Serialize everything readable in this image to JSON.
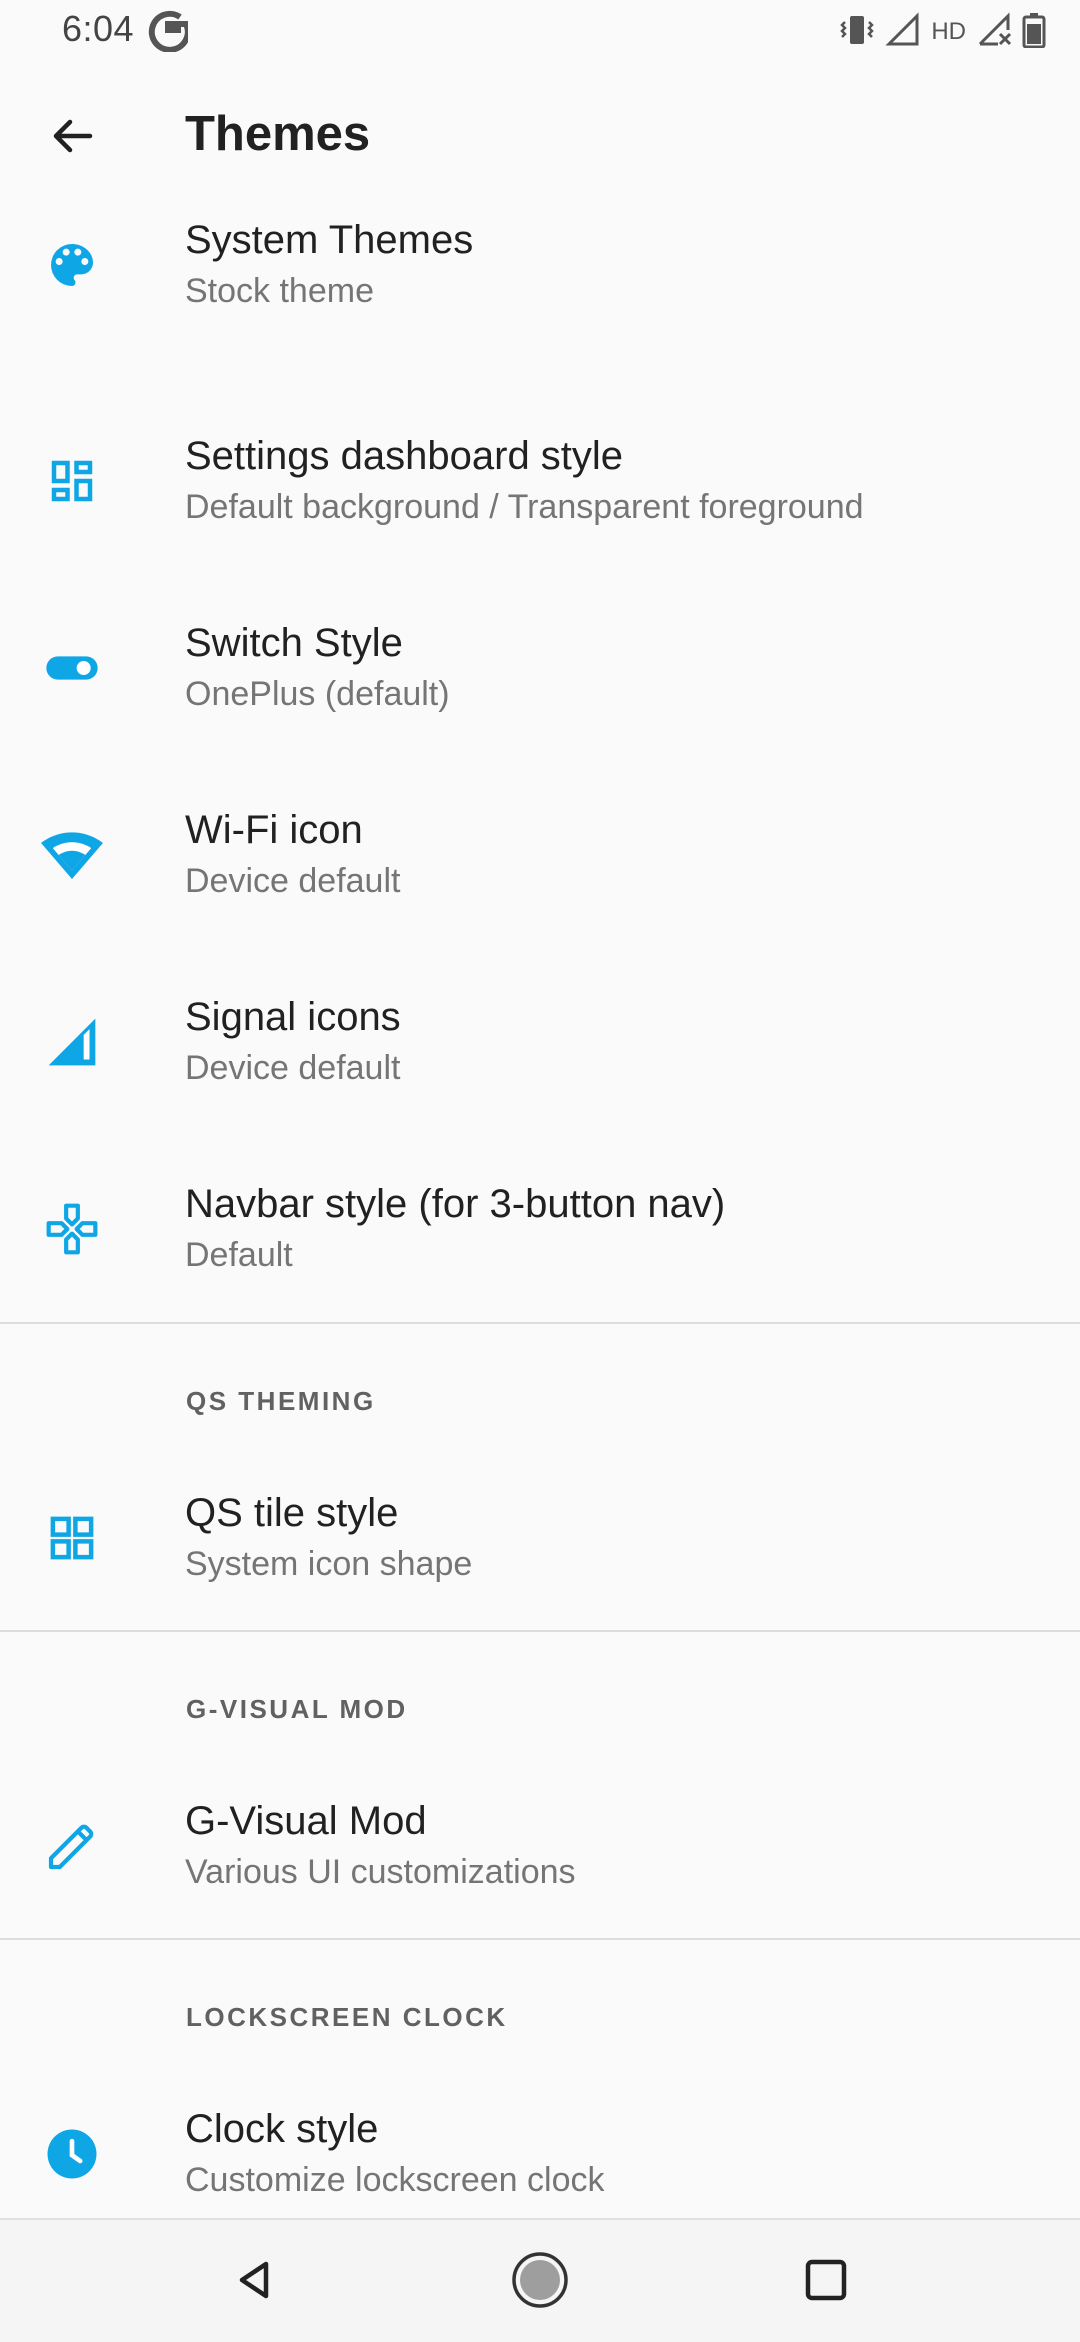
{
  "status_bar": {
    "time": "6:04",
    "network_label": "HD"
  },
  "app_bar": {
    "title": "Themes",
    "back_icon": "arrow-back-icon"
  },
  "accent_color": "#0fa6e6",
  "items_group1": [
    {
      "title": "System Themes",
      "summary": "Stock theme",
      "icon": "palette-icon"
    },
    {
      "title": "Settings dashboard style",
      "summary": "Default background / Transparent foreground",
      "icon": "dashboard-icon"
    },
    {
      "title": "Switch Style",
      "summary": "OnePlus (default)",
      "icon": "toggle-icon"
    },
    {
      "title": "Wi-Fi icon",
      "summary": "Device default",
      "icon": "wifi-icon"
    },
    {
      "title": "Signal icons",
      "summary": "Device default",
      "icon": "signal-icon"
    },
    {
      "title": "Navbar style (for 3-button nav)",
      "summary": "Default",
      "icon": "gamepad-icon"
    }
  ],
  "categories": {
    "qs": "QS THEMING",
    "gvisual": "G-VISUAL MOD",
    "lockclock": "LOCKSCREEN CLOCK"
  },
  "qs_item": {
    "title": "QS tile style",
    "summary": "System icon shape",
    "icon": "grid-icon"
  },
  "gvisual_item": {
    "title": "G-Visual Mod",
    "summary": "Various UI customizations",
    "icon": "pencil-icon"
  },
  "clock_item": {
    "title": "Clock style",
    "summary": "Customize lockscreen clock",
    "icon": "clock-icon"
  },
  "nav_bar": {
    "back": "nav-back-icon",
    "home": "nav-home-icon",
    "recents": "nav-recents-icon"
  }
}
